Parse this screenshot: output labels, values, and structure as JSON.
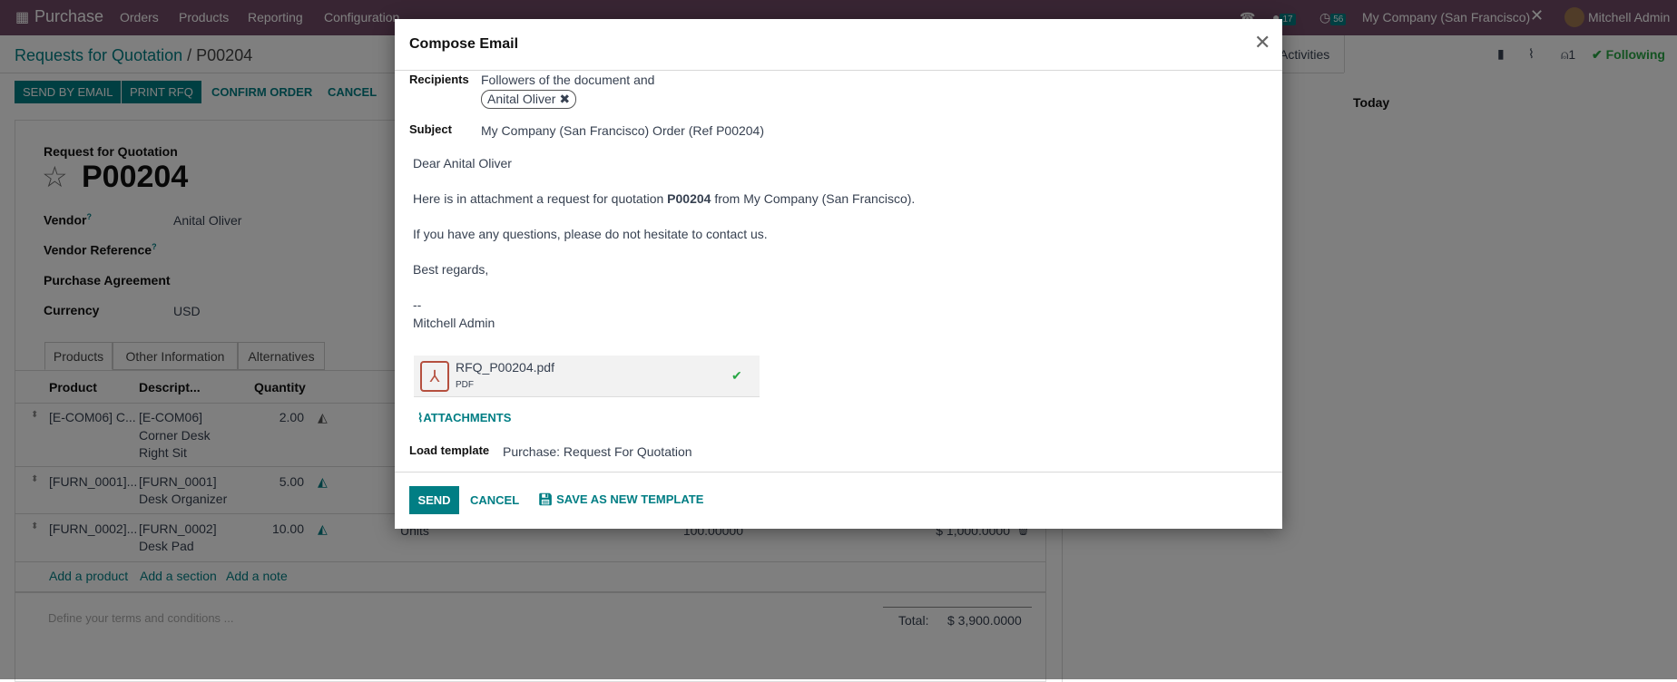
{
  "navbar": {
    "app": "Purchase",
    "menus": [
      "Orders",
      "Products",
      "Reporting",
      "Configuration"
    ],
    "chat_count": "17",
    "activity_count": "56",
    "company": "My Company (San Francisco)",
    "user": "Mitchell Admin"
  },
  "breadcrumb": {
    "parent": "Requests for Quotation",
    "separator": "/",
    "current": "P00204"
  },
  "actions": {
    "send_by_email": "SEND BY EMAIL",
    "print_rfq": "PRINT RFQ",
    "confirm_order": "CONFIRM ORDER",
    "cancel": "CANCEL"
  },
  "chatter": {
    "activities": "Activities",
    "followers_count": "1",
    "following": "Following",
    "today": "Today"
  },
  "form": {
    "type_label": "Request for Quotation",
    "name": "P00204",
    "fields": [
      {
        "label": "Vendor",
        "help": "?",
        "value": "Anital Oliver"
      },
      {
        "label": "Vendor Reference",
        "help": "?",
        "value": ""
      },
      {
        "label": "Purchase Agreement",
        "value": ""
      },
      {
        "label": "Currency",
        "value": "USD"
      }
    ],
    "tabs": [
      "Products",
      "Other Information",
      "Alternatives"
    ],
    "columns": [
      "Product",
      "Descript...",
      "Quantity"
    ],
    "rows": [
      {
        "product": "[E-COM06] C...",
        "description": [
          "[E-COM06]",
          "Corner Desk",
          "Right Sit"
        ],
        "quantity": "2.00"
      },
      {
        "product": "[FURN_0001]...",
        "description": [
          "[FURN_0001]",
          "Desk Organizer"
        ],
        "quantity": "5.00"
      },
      {
        "product": "[FURN_0002]...",
        "description": [
          "[FURN_0002]",
          "Desk Pad"
        ],
        "quantity": "10.00",
        "uom": "Units",
        "unit_price": "100.00000",
        "subtotal": "$ 1,000.0000"
      }
    ],
    "add_links": [
      "Add a product",
      "Add a section",
      "Add a note"
    ],
    "terms_placeholder": "Define your terms and conditions ...",
    "total_label": "Total:",
    "total_value": "$ 3,900.0000"
  },
  "modal": {
    "title": "Compose Email",
    "recipients_label": "Recipients",
    "recipients_text": "Followers of the document and",
    "recipient_chip": "Anital Oliver",
    "subject_label": "Subject",
    "subject": "My Company (San Francisco) Order (Ref P00204)",
    "body": {
      "greeting": "Dear Anital Oliver",
      "line1_pre": "Here is in attachment a request for quotation ",
      "line1_bold": "P00204",
      "line1_post": " from My Company (San Francisco).",
      "line2": "If you have any questions, please do not hesitate to contact us.",
      "closing": "Best regards,",
      "sig_sep": "--",
      "signature": "Mitchell Admin"
    },
    "attachment": {
      "name": "RFQ_P00204.pdf",
      "type": "PDF"
    },
    "attachments_button": "ATTACHMENTS",
    "template_label": "Load template",
    "template_value": "Purchase: Request For Quotation",
    "send": "SEND",
    "cancel": "CANCEL",
    "save_template": "SAVE AS NEW TEMPLATE"
  },
  "colors": {
    "brand": "#714b67",
    "accent": "#017e84",
    "success": "#28a745"
  }
}
